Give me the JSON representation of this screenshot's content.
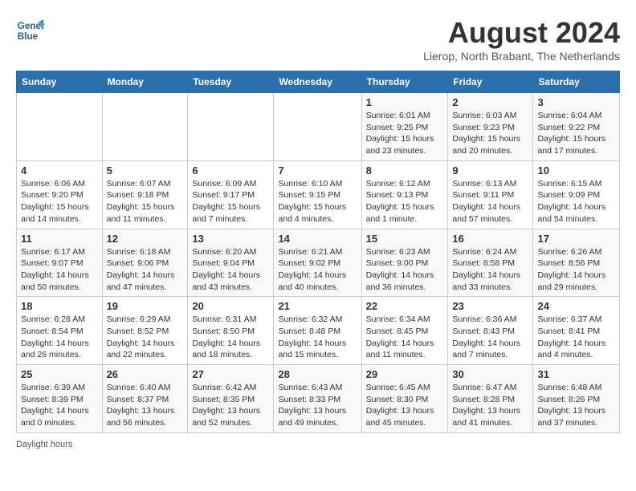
{
  "header": {
    "logo_line1": "General",
    "logo_line2": "Blue",
    "title": "August 2024",
    "subtitle": "Lierop, North Brabant, The Netherlands"
  },
  "days_of_week": [
    "Sunday",
    "Monday",
    "Tuesday",
    "Wednesday",
    "Thursday",
    "Friday",
    "Saturday"
  ],
  "weeks": [
    [
      {
        "day": "",
        "info": ""
      },
      {
        "day": "",
        "info": ""
      },
      {
        "day": "",
        "info": ""
      },
      {
        "day": "",
        "info": ""
      },
      {
        "day": "1",
        "info": "Sunrise: 6:01 AM\nSunset: 9:25 PM\nDaylight: 15 hours\nand 23 minutes."
      },
      {
        "day": "2",
        "info": "Sunrise: 6:03 AM\nSunset: 9:23 PM\nDaylight: 15 hours\nand 20 minutes."
      },
      {
        "day": "3",
        "info": "Sunrise: 6:04 AM\nSunset: 9:22 PM\nDaylight: 15 hours\nand 17 minutes."
      }
    ],
    [
      {
        "day": "4",
        "info": "Sunrise: 6:06 AM\nSunset: 9:20 PM\nDaylight: 15 hours\nand 14 minutes."
      },
      {
        "day": "5",
        "info": "Sunrise: 6:07 AM\nSunset: 9:18 PM\nDaylight: 15 hours\nand 11 minutes."
      },
      {
        "day": "6",
        "info": "Sunrise: 6:09 AM\nSunset: 9:17 PM\nDaylight: 15 hours\nand 7 minutes."
      },
      {
        "day": "7",
        "info": "Sunrise: 6:10 AM\nSunset: 9:15 PM\nDaylight: 15 hours\nand 4 minutes."
      },
      {
        "day": "8",
        "info": "Sunrise: 6:12 AM\nSunset: 9:13 PM\nDaylight: 15 hours\nand 1 minute."
      },
      {
        "day": "9",
        "info": "Sunrise: 6:13 AM\nSunset: 9:11 PM\nDaylight: 14 hours\nand 57 minutes."
      },
      {
        "day": "10",
        "info": "Sunrise: 6:15 AM\nSunset: 9:09 PM\nDaylight: 14 hours\nand 54 minutes."
      }
    ],
    [
      {
        "day": "11",
        "info": "Sunrise: 6:17 AM\nSunset: 9:07 PM\nDaylight: 14 hours\nand 50 minutes."
      },
      {
        "day": "12",
        "info": "Sunrise: 6:18 AM\nSunset: 9:06 PM\nDaylight: 14 hours\nand 47 minutes."
      },
      {
        "day": "13",
        "info": "Sunrise: 6:20 AM\nSunset: 9:04 PM\nDaylight: 14 hours\nand 43 minutes."
      },
      {
        "day": "14",
        "info": "Sunrise: 6:21 AM\nSunset: 9:02 PM\nDaylight: 14 hours\nand 40 minutes."
      },
      {
        "day": "15",
        "info": "Sunrise: 6:23 AM\nSunset: 9:00 PM\nDaylight: 14 hours\nand 36 minutes."
      },
      {
        "day": "16",
        "info": "Sunrise: 6:24 AM\nSunset: 8:58 PM\nDaylight: 14 hours\nand 33 minutes."
      },
      {
        "day": "17",
        "info": "Sunrise: 6:26 AM\nSunset: 8:56 PM\nDaylight: 14 hours\nand 29 minutes."
      }
    ],
    [
      {
        "day": "18",
        "info": "Sunrise: 6:28 AM\nSunset: 8:54 PM\nDaylight: 14 hours\nand 26 minutes."
      },
      {
        "day": "19",
        "info": "Sunrise: 6:29 AM\nSunset: 8:52 PM\nDaylight: 14 hours\nand 22 minutes."
      },
      {
        "day": "20",
        "info": "Sunrise: 6:31 AM\nSunset: 8:50 PM\nDaylight: 14 hours\nand 18 minutes."
      },
      {
        "day": "21",
        "info": "Sunrise: 6:32 AM\nSunset: 8:48 PM\nDaylight: 14 hours\nand 15 minutes."
      },
      {
        "day": "22",
        "info": "Sunrise: 6:34 AM\nSunset: 8:45 PM\nDaylight: 14 hours\nand 11 minutes."
      },
      {
        "day": "23",
        "info": "Sunrise: 6:36 AM\nSunset: 8:43 PM\nDaylight: 14 hours\nand 7 minutes."
      },
      {
        "day": "24",
        "info": "Sunrise: 6:37 AM\nSunset: 8:41 PM\nDaylight: 14 hours\nand 4 minutes."
      }
    ],
    [
      {
        "day": "25",
        "info": "Sunrise: 6:39 AM\nSunset: 8:39 PM\nDaylight: 14 hours\nand 0 minutes."
      },
      {
        "day": "26",
        "info": "Sunrise: 6:40 AM\nSunset: 8:37 PM\nDaylight: 13 hours\nand 56 minutes."
      },
      {
        "day": "27",
        "info": "Sunrise: 6:42 AM\nSunset: 8:35 PM\nDaylight: 13 hours\nand 52 minutes."
      },
      {
        "day": "28",
        "info": "Sunrise: 6:43 AM\nSunset: 8:33 PM\nDaylight: 13 hours\nand 49 minutes."
      },
      {
        "day": "29",
        "info": "Sunrise: 6:45 AM\nSunset: 8:30 PM\nDaylight: 13 hours\nand 45 minutes."
      },
      {
        "day": "30",
        "info": "Sunrise: 6:47 AM\nSunset: 8:28 PM\nDaylight: 13 hours\nand 41 minutes."
      },
      {
        "day": "31",
        "info": "Sunrise: 6:48 AM\nSunset: 8:26 PM\nDaylight: 13 hours\nand 37 minutes."
      }
    ]
  ],
  "footer": {
    "note": "Daylight hours"
  }
}
